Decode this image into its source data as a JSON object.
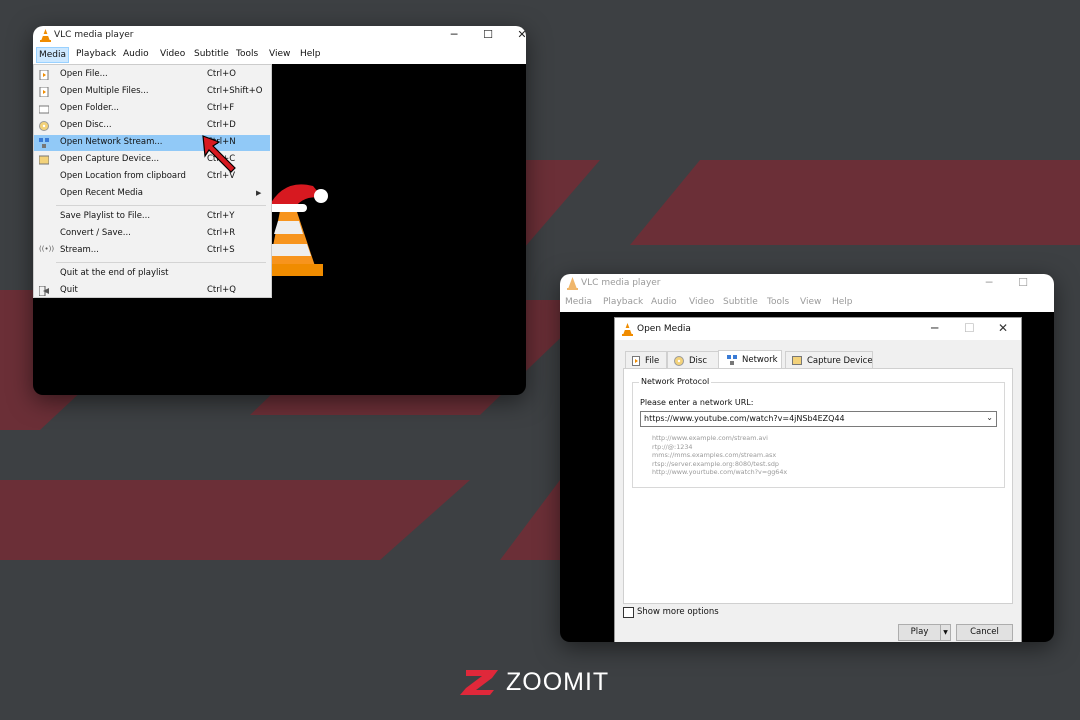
{
  "vlc_window": {
    "title": "VLC media player",
    "menubar": [
      "Media",
      "Playback",
      "Audio",
      "Video",
      "Subtitle",
      "Tools",
      "View",
      "Help"
    ],
    "media_menu": [
      {
        "label": "Open File...",
        "shortcut": "Ctrl+O",
        "icon": "file-icon"
      },
      {
        "label": "Open Multiple Files...",
        "shortcut": "Ctrl+Shift+O",
        "icon": "files-icon"
      },
      {
        "label": "Open Folder...",
        "shortcut": "Ctrl+F",
        "icon": "folder-icon"
      },
      {
        "label": "Open Disc...",
        "shortcut": "Ctrl+D",
        "icon": "disc-icon"
      },
      {
        "label": "Open Network Stream...",
        "shortcut": "Ctrl+N",
        "icon": "network-icon",
        "highlighted": true
      },
      {
        "label": "Open Capture Device...",
        "shortcut": "Ctrl+C",
        "icon": "capture-icon"
      },
      {
        "label": "Open Location from clipboard",
        "shortcut": "Ctrl+V"
      },
      {
        "label": "Open Recent Media",
        "shortcut": "",
        "submenu": true
      },
      {
        "label": "Save Playlist to File...",
        "shortcut": "Ctrl+Y"
      },
      {
        "label": "Convert / Save...",
        "shortcut": "Ctrl+R"
      },
      {
        "label": "Stream...",
        "shortcut": "Ctrl+S",
        "icon": "stream-icon"
      },
      {
        "label": "Quit at the end of playlist",
        "shortcut": ""
      },
      {
        "label": "Quit",
        "shortcut": "Ctrl+Q",
        "icon": "quit-icon"
      }
    ]
  },
  "vlc_window2": {
    "title": "VLC media player",
    "menubar": [
      "Media",
      "Playback",
      "Audio",
      "Video",
      "Subtitle",
      "Tools",
      "View",
      "Help"
    ]
  },
  "open_media": {
    "title": "Open Media",
    "tabs": [
      "File",
      "Disc",
      "Network",
      "Capture Device"
    ],
    "active_tab": "Network",
    "group_label": "Network Protocol",
    "prompt": "Please enter a network URL:",
    "url_value": "https://www.youtube.com/watch?v=4jNSb4EZQ44",
    "examples": [
      "http://www.example.com/stream.avi",
      "rtp://@:1234",
      "mms://mms.examples.com/stream.asx",
      "rtsp://server.example.org:8080/test.sdp",
      "http://www.yourtube.com/watch?v=gg64x"
    ],
    "show_more": "Show more options",
    "play_label": "Play",
    "cancel_label": "Cancel"
  },
  "logo": {
    "text": "ZOOMIT"
  },
  "colors": {
    "background": "#3d4043",
    "stripe": "#6b2f37",
    "highlight": "#91c9f7",
    "logo_accent": "#e0283a"
  }
}
